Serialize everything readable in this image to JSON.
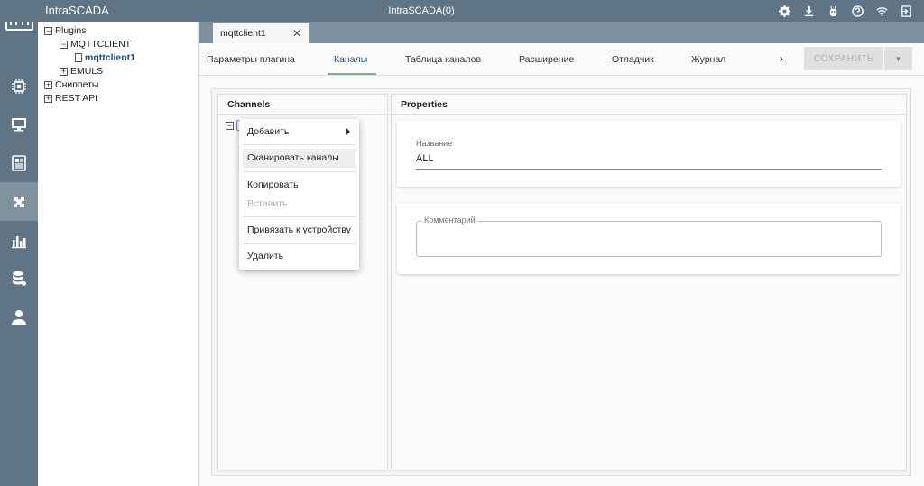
{
  "app": {
    "name": "IntraSCADA",
    "title": "IntraSCADA(0)",
    "colors": {
      "bar": "#5f7585",
      "accent": "#1e4d8c"
    }
  },
  "topbar_icons": [
    "gear-icon",
    "download-icon",
    "robot-icon",
    "help-icon",
    "wifi-icon",
    "logout-icon"
  ],
  "rail": {
    "items": [
      "cpu-icon",
      "monitor-icon",
      "report-icon",
      "plugin-icon",
      "chart-icon",
      "database-icon",
      "user-icon"
    ],
    "active": "plugin-icon"
  },
  "tree": {
    "plugins": "Plugins",
    "mqttclient": "MQTTCLIENT",
    "mqttclient1": "mqttclient1",
    "emuls": "EMULS",
    "snippets": "Сниппеты",
    "rest_api": "REST API"
  },
  "doc_tab": {
    "label": "mqttclient1",
    "close": "✕"
  },
  "nav": {
    "tabs": [
      "Параметры плагина",
      "Каналы",
      "Таблица каналов",
      "Расширение",
      "Отладчик",
      "Журнал"
    ],
    "active": "Каналы",
    "more": "›",
    "save": "СОХРАНИТЬ",
    "dropdown": "▼"
  },
  "channels": {
    "title": "Channels",
    "node_toggle": "−"
  },
  "properties": {
    "title": "Properties",
    "name_label": "Название",
    "name_value": "ALL",
    "comment_label": "Комментарий",
    "comment_value": ""
  },
  "context_menu": {
    "add": "Добавить",
    "scan": "Сканировать каналы",
    "copy": "Копировать",
    "paste": "Вставить",
    "bind": "Привязать к устройству",
    "delete": "Удалить"
  }
}
